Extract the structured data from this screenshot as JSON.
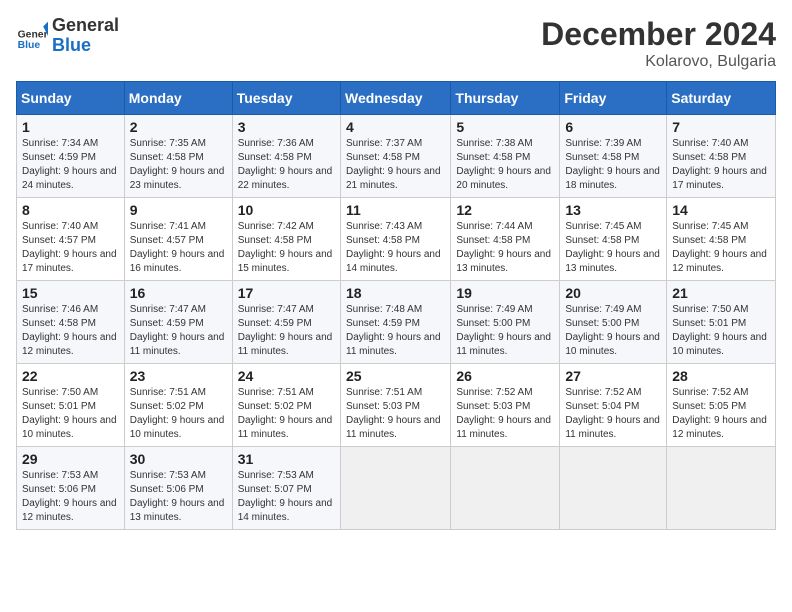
{
  "header": {
    "logo_general": "General",
    "logo_blue": "Blue",
    "month_title": "December 2024",
    "location": "Kolarovo, Bulgaria"
  },
  "weekdays": [
    "Sunday",
    "Monday",
    "Tuesday",
    "Wednesday",
    "Thursday",
    "Friday",
    "Saturday"
  ],
  "weeks": [
    [
      {
        "day": "1",
        "sunrise": "7:34 AM",
        "sunset": "4:59 PM",
        "daylight": "9 hours and 24 minutes."
      },
      {
        "day": "2",
        "sunrise": "7:35 AM",
        "sunset": "4:58 PM",
        "daylight": "9 hours and 23 minutes."
      },
      {
        "day": "3",
        "sunrise": "7:36 AM",
        "sunset": "4:58 PM",
        "daylight": "9 hours and 22 minutes."
      },
      {
        "day": "4",
        "sunrise": "7:37 AM",
        "sunset": "4:58 PM",
        "daylight": "9 hours and 21 minutes."
      },
      {
        "day": "5",
        "sunrise": "7:38 AM",
        "sunset": "4:58 PM",
        "daylight": "9 hours and 20 minutes."
      },
      {
        "day": "6",
        "sunrise": "7:39 AM",
        "sunset": "4:58 PM",
        "daylight": "9 hours and 18 minutes."
      },
      {
        "day": "7",
        "sunrise": "7:40 AM",
        "sunset": "4:58 PM",
        "daylight": "9 hours and 17 minutes."
      }
    ],
    [
      {
        "day": "8",
        "sunrise": "7:40 AM",
        "sunset": "4:57 PM",
        "daylight": "9 hours and 17 minutes."
      },
      {
        "day": "9",
        "sunrise": "7:41 AM",
        "sunset": "4:57 PM",
        "daylight": "9 hours and 16 minutes."
      },
      {
        "day": "10",
        "sunrise": "7:42 AM",
        "sunset": "4:58 PM",
        "daylight": "9 hours and 15 minutes."
      },
      {
        "day": "11",
        "sunrise": "7:43 AM",
        "sunset": "4:58 PM",
        "daylight": "9 hours and 14 minutes."
      },
      {
        "day": "12",
        "sunrise": "7:44 AM",
        "sunset": "4:58 PM",
        "daylight": "9 hours and 13 minutes."
      },
      {
        "day": "13",
        "sunrise": "7:45 AM",
        "sunset": "4:58 PM",
        "daylight": "9 hours and 13 minutes."
      },
      {
        "day": "14",
        "sunrise": "7:45 AM",
        "sunset": "4:58 PM",
        "daylight": "9 hours and 12 minutes."
      }
    ],
    [
      {
        "day": "15",
        "sunrise": "7:46 AM",
        "sunset": "4:58 PM",
        "daylight": "9 hours and 12 minutes."
      },
      {
        "day": "16",
        "sunrise": "7:47 AM",
        "sunset": "4:59 PM",
        "daylight": "9 hours and 11 minutes."
      },
      {
        "day": "17",
        "sunrise": "7:47 AM",
        "sunset": "4:59 PM",
        "daylight": "9 hours and 11 minutes."
      },
      {
        "day": "18",
        "sunrise": "7:48 AM",
        "sunset": "4:59 PM",
        "daylight": "9 hours and 11 minutes."
      },
      {
        "day": "19",
        "sunrise": "7:49 AM",
        "sunset": "5:00 PM",
        "daylight": "9 hours and 11 minutes."
      },
      {
        "day": "20",
        "sunrise": "7:49 AM",
        "sunset": "5:00 PM",
        "daylight": "9 hours and 10 minutes."
      },
      {
        "day": "21",
        "sunrise": "7:50 AM",
        "sunset": "5:01 PM",
        "daylight": "9 hours and 10 minutes."
      }
    ],
    [
      {
        "day": "22",
        "sunrise": "7:50 AM",
        "sunset": "5:01 PM",
        "daylight": "9 hours and 10 minutes."
      },
      {
        "day": "23",
        "sunrise": "7:51 AM",
        "sunset": "5:02 PM",
        "daylight": "9 hours and 10 minutes."
      },
      {
        "day": "24",
        "sunrise": "7:51 AM",
        "sunset": "5:02 PM",
        "daylight": "9 hours and 11 minutes."
      },
      {
        "day": "25",
        "sunrise": "7:51 AM",
        "sunset": "5:03 PM",
        "daylight": "9 hours and 11 minutes."
      },
      {
        "day": "26",
        "sunrise": "7:52 AM",
        "sunset": "5:03 PM",
        "daylight": "9 hours and 11 minutes."
      },
      {
        "day": "27",
        "sunrise": "7:52 AM",
        "sunset": "5:04 PM",
        "daylight": "9 hours and 11 minutes."
      },
      {
        "day": "28",
        "sunrise": "7:52 AM",
        "sunset": "5:05 PM",
        "daylight": "9 hours and 12 minutes."
      }
    ],
    [
      {
        "day": "29",
        "sunrise": "7:53 AM",
        "sunset": "5:06 PM",
        "daylight": "9 hours and 12 minutes."
      },
      {
        "day": "30",
        "sunrise": "7:53 AM",
        "sunset": "5:06 PM",
        "daylight": "9 hours and 13 minutes."
      },
      {
        "day": "31",
        "sunrise": "7:53 AM",
        "sunset": "5:07 PM",
        "daylight": "9 hours and 14 minutes."
      },
      null,
      null,
      null,
      null
    ]
  ]
}
